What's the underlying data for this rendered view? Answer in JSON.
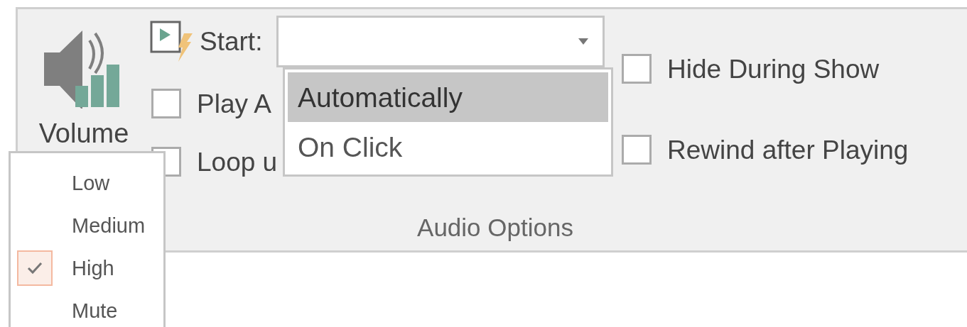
{
  "volume": {
    "label": "Volume",
    "menu": [
      {
        "label": "Low",
        "selected": false
      },
      {
        "label": "Medium",
        "selected": false
      },
      {
        "label": "High",
        "selected": true
      },
      {
        "label": "Mute",
        "selected": false
      }
    ]
  },
  "start": {
    "label": "Start:",
    "options": [
      {
        "label": "Automatically",
        "selected": true
      },
      {
        "label": "On Click",
        "selected": false
      }
    ]
  },
  "checkboxes": [
    {
      "label": "Play A",
      "checked": false
    },
    {
      "label": "Loop u",
      "checked": false
    },
    {
      "label": "Hide During Show",
      "checked": false
    },
    {
      "label": "Rewind after Playing",
      "checked": false
    }
  ],
  "group_label": "Audio Options"
}
